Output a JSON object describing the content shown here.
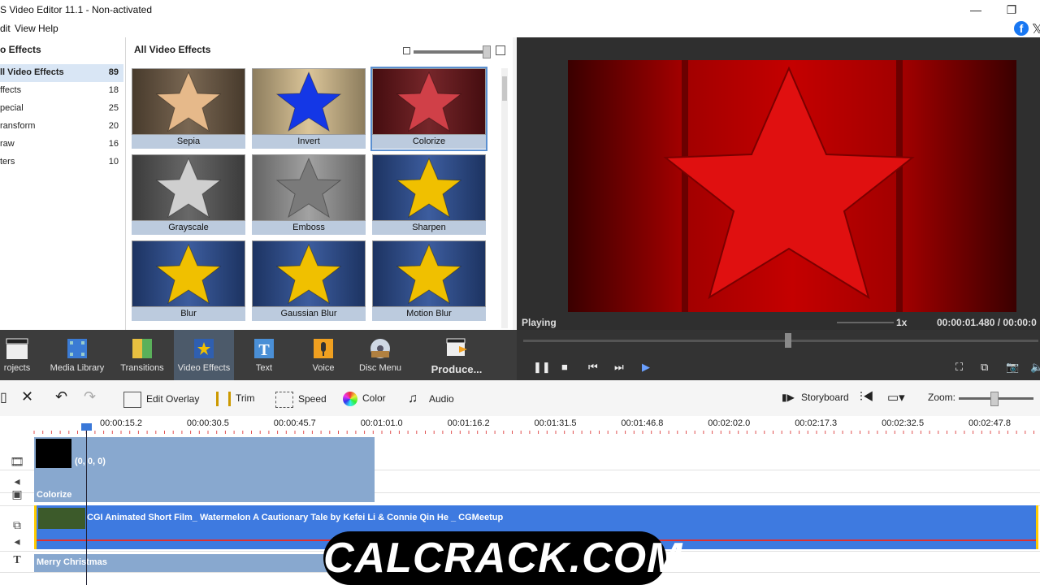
{
  "window": {
    "title": "S Video Editor 11.1 - Non-activated",
    "minimize": "—",
    "maximize": "❐"
  },
  "menu": [
    "dit",
    "View",
    "Help"
  ],
  "categories": {
    "title": "o Effects",
    "items": [
      {
        "label": "ll Video Effects",
        "count": "89"
      },
      {
        "label": "ffects",
        "count": "18"
      },
      {
        "label": "pecial",
        "count": "25"
      },
      {
        "label": "ransform",
        "count": "20"
      },
      {
        "label": "raw",
        "count": "16"
      },
      {
        "label": "ters",
        "count": "10"
      }
    ]
  },
  "effects": {
    "title": "All Video Effects",
    "tiles": [
      {
        "label": "Sepia",
        "bg": "#6e5a44",
        "star": "#e6b98a"
      },
      {
        "label": "Invert",
        "bg": "#d8c090",
        "star": "#1437e6"
      },
      {
        "label": "Colorize",
        "bg": "#6a1418",
        "star": "#d04048"
      },
      {
        "label": "Grayscale",
        "bg": "#5b5b5b",
        "star": "#cfcfcf"
      },
      {
        "label": "Emboss",
        "bg": "#9a9a9a",
        "star": "#7a7a7a"
      },
      {
        "label": "Sharpen",
        "bg": "#2c4f96",
        "star": "#f0c000"
      },
      {
        "label": "Blur",
        "bg": "#2c4f96",
        "star": "#f0c000"
      },
      {
        "label": "Gaussian Blur",
        "bg": "#2c4f96",
        "star": "#f0c000"
      },
      {
        "label": "Motion Blur",
        "bg": "#2c4f96",
        "star": "#f0c000"
      }
    ]
  },
  "preview": {
    "status": "Playing",
    "speed": "1x",
    "timecode": "00:00:01.480  /  00:00:0"
  },
  "modes": [
    {
      "label": "rojects",
      "icon": "clapper-icon"
    },
    {
      "label": "Media Library",
      "icon": "film-icon"
    },
    {
      "label": "Transitions",
      "icon": "transitions-icon"
    },
    {
      "label": "Video Effects",
      "icon": "star-icon"
    },
    {
      "label": "Text",
      "icon": "text-icon"
    },
    {
      "label": "Voice",
      "icon": "microphone-icon"
    },
    {
      "label": "Disc Menu",
      "icon": "disc-icon"
    },
    {
      "label": "Produce...",
      "icon": "produce-icon"
    }
  ],
  "toolbar": {
    "edit_overlay": "Edit Overlay",
    "trim": "Trim",
    "speed": "Speed",
    "color": "Color",
    "audio": "Audio",
    "storyboard": "Storyboard",
    "zoom": "Zoom:"
  },
  "ruler": [
    "00:00:15.2",
    "00:00:30.5",
    "00:00:45.7",
    "00:01:01.0",
    "00:01:16.2",
    "00:01:31.5",
    "00:01:46.8",
    "00:02:02.0",
    "00:02:17.3",
    "00:02:32.5",
    "00:02:47.8"
  ],
  "tracks": {
    "overlay_label": "(0, 0, 0)",
    "effect_label": "Colorize",
    "video_title": "CGI Animated Short Film_  Watermelon A Cautionary Tale  by Kefei Li & Connie Qin He _ CGMeetup",
    "text_label": "Merry Christmas"
  },
  "watermark": "CALCRACK.COM",
  "colors": {
    "preview_bg": "#7a0000",
    "track_clip": "#88a8cf",
    "video_clip": "#3e7ae0",
    "mode_bar": "#3c3c3c"
  }
}
